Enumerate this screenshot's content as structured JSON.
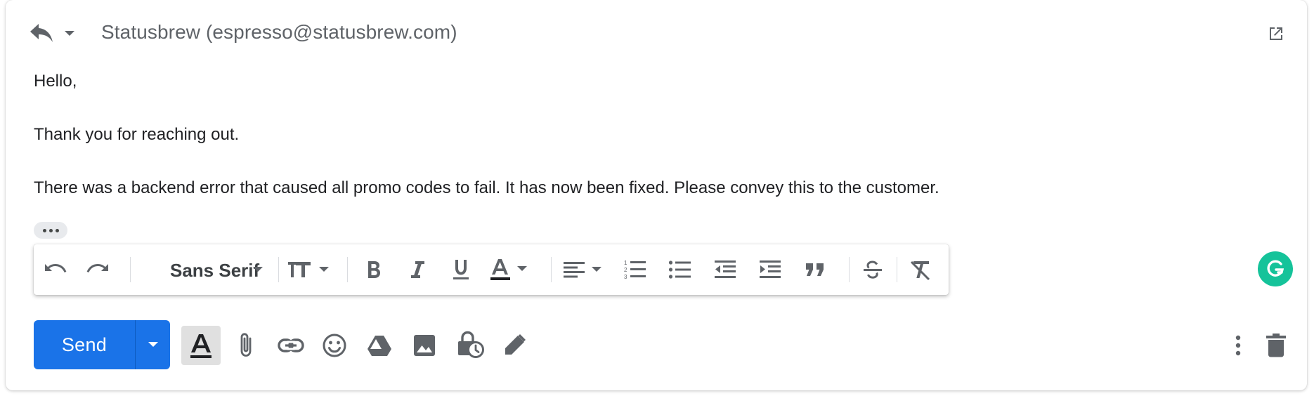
{
  "compose": {
    "from": "Statusbrew (espresso@statusbrew.com)",
    "body": {
      "greeting": "Hello,",
      "line1": "Thank you for reaching out.",
      "line2": "There was a backend error that caused all promo codes to fail. It has now been fixed. Please convey this to the customer."
    }
  },
  "formatting": {
    "font": "Sans Serif"
  },
  "actions": {
    "send_label": "Send"
  },
  "colors": {
    "accent": "#1a73e8",
    "icon": "#5f6368",
    "grammarly": "#15c39a"
  },
  "icons": [
    "reply-icon",
    "reply-options-icon",
    "popout-icon",
    "undo-icon",
    "redo-icon",
    "font-dropdown-icon",
    "font-size-icon",
    "bold-icon",
    "italic-icon",
    "underline-icon",
    "text-color-icon",
    "align-icon",
    "numbered-list-icon",
    "bulleted-list-icon",
    "indent-less-icon",
    "indent-more-icon",
    "quote-icon",
    "strikethrough-icon",
    "remove-formatting-icon",
    "grammarly-icon",
    "formatting-options-icon",
    "attach-icon",
    "link-icon",
    "emoji-icon",
    "drive-icon",
    "photo-icon",
    "confidential-icon",
    "signature-icon",
    "more-options-icon",
    "trash-icon"
  ]
}
